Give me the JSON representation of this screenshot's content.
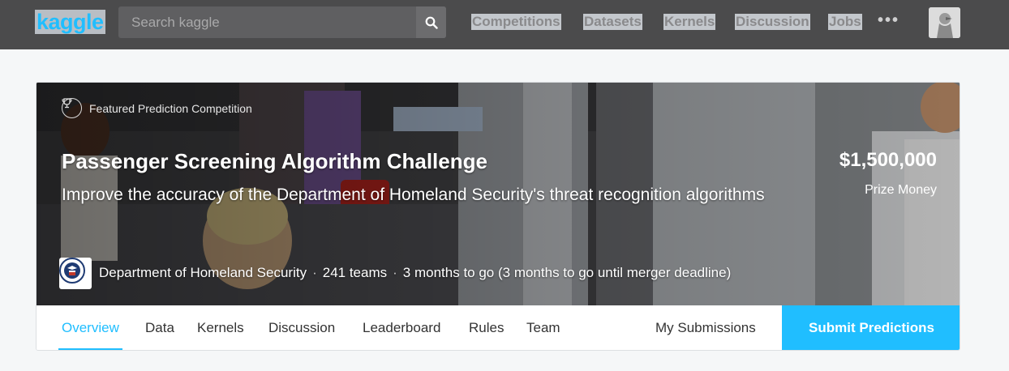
{
  "header": {
    "logo": "kaggle",
    "search_placeholder": "Search kaggle",
    "nav": [
      "Competitions",
      "Datasets",
      "Kernels",
      "Discussion",
      "Jobs"
    ],
    "more": "•••"
  },
  "competition": {
    "badge": "Featured Prediction Competition",
    "title": "Passenger Screening Algorithm Challenge",
    "subtitle": "Improve the accuracy of the Department of Homeland Security's threat recognition algorithms",
    "prize": "$1,500,000",
    "prize_label": "Prize Money",
    "host": "Department of Homeland Security",
    "teams": "241 teams",
    "deadline": "3 months to go (3 months to go until merger deadline)"
  },
  "tabs": {
    "items": [
      "Overview",
      "Data",
      "Kernels",
      "Discussion",
      "Leaderboard",
      "Rules",
      "Team"
    ],
    "active": "Overview",
    "my_submissions": "My Submissions",
    "submit": "Submit Predictions"
  },
  "colors": {
    "accent": "#20beff",
    "topbar": "#4b4b4c"
  },
  "icons": [
    "search-icon",
    "trophy-icon",
    "more-icon",
    "user-avatar",
    "dhs-seal"
  ]
}
